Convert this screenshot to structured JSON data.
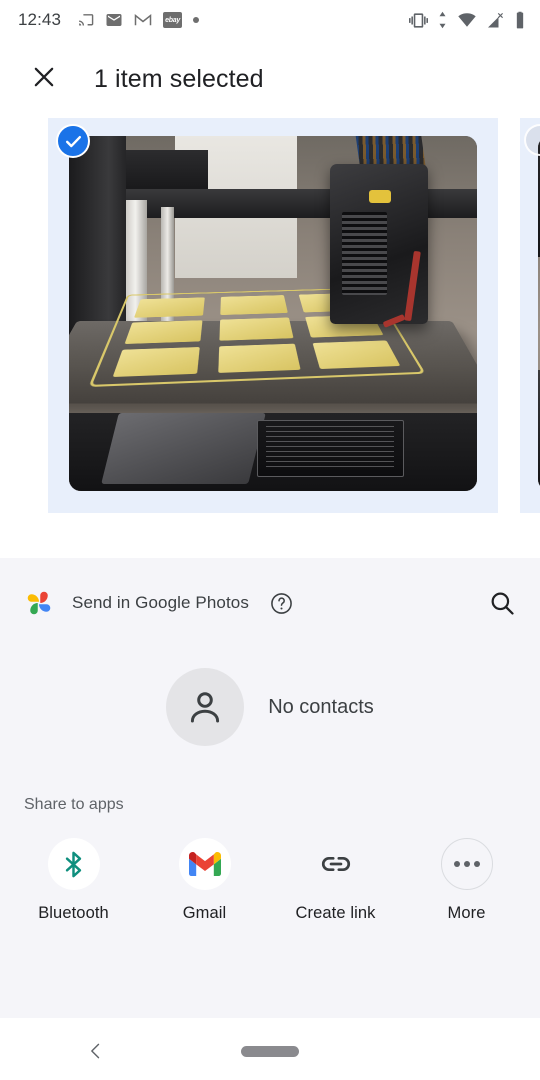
{
  "status_bar": {
    "time": "12:43",
    "left_icons": [
      "cast-icon",
      "mail-icon",
      "gmail-icon",
      "ebay-icon",
      "more-notification-dot-icon"
    ],
    "ebay_label": "ebay",
    "right_icons": [
      "vibrate-icon",
      "data-transfer-icon",
      "wifi-icon",
      "cellular-no-signal-icon",
      "battery-icon"
    ]
  },
  "header": {
    "close_icon": "close-icon",
    "title": "1 item selected"
  },
  "image_strip": {
    "items": [
      {
        "name": "3d-printer-photo",
        "selected": true,
        "badge": "check-circle-icon"
      },
      {
        "name": "3d-printer-photo-2",
        "selected": false,
        "badge": "unchecked-circle-icon"
      }
    ]
  },
  "share_sheet": {
    "app_row": {
      "logo": "google-photos-icon",
      "label": "Send in Google Photos",
      "help_icon": "help-circle-icon",
      "search_icon": "search-icon"
    },
    "contacts": {
      "avatar_icon": "person-icon",
      "label": "No contacts"
    },
    "apps_section_label": "Share to apps",
    "apps": [
      {
        "label": "Bluetooth",
        "icon": "bluetooth-icon"
      },
      {
        "label": "Gmail",
        "icon": "gmail-icon"
      },
      {
        "label": "Create link",
        "icon": "link-icon"
      },
      {
        "label": "More",
        "icon": "more-horizontal-icon"
      }
    ]
  },
  "nav_bar": {
    "back_icon": "back-chevron-icon",
    "home_pill": "home-pill-handle"
  },
  "colors": {
    "accent_blue": "#1a73e8",
    "selected_tint": "#e8effb",
    "sheet_bg": "#f5f5f9",
    "text_primary": "#202124",
    "text_secondary": "#5f6368",
    "bluetooth_teal": "#0f8f7e"
  }
}
